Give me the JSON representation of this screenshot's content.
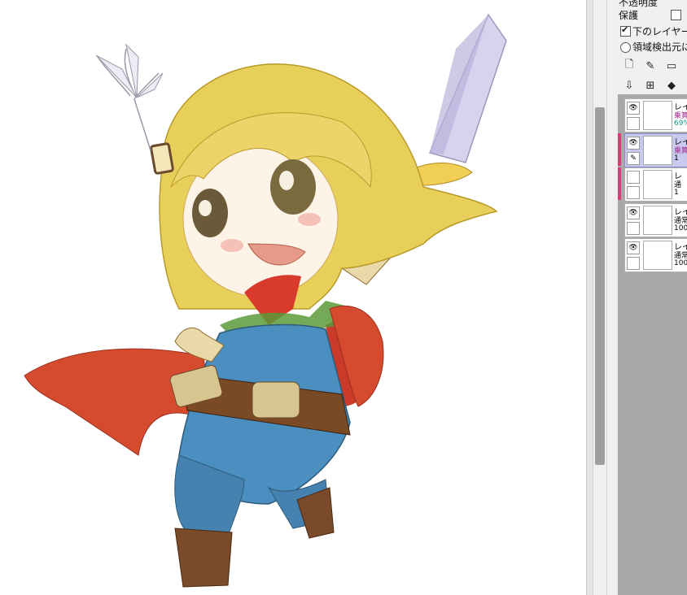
{
  "panel": {
    "top_cut_label": "不透明度",
    "protect_label": "保護",
    "clip_checkbox_label": "下のレイヤーで",
    "clip_checked": true,
    "region_source_label": "領域検出元に",
    "region_checked": false
  },
  "toolbar_row1": [
    {
      "icon": "new-layer-icon"
    },
    {
      "icon": "pen-tool-icon"
    },
    {
      "icon": "layer-folder-icon"
    }
  ],
  "toolbar_row2": [
    {
      "icon": "merge-down-icon"
    },
    {
      "icon": "new-layer-plus-icon"
    },
    {
      "icon": "eraser-icon"
    },
    {
      "icon": "delete-layer-icon"
    }
  ],
  "layers": [
    {
      "name": "レイ",
      "mode": "乗算",
      "opacity": "69%",
      "mode_color": "#a0308a",
      "op_color": "#1a9a8a",
      "visible": true,
      "selected": false,
      "pink": false
    },
    {
      "name": "レイ",
      "mode": "乗算",
      "opacity": "1",
      "mode_color": "#a0308a",
      "op_color": "#111111",
      "visible": true,
      "selected": true,
      "pink": true
    },
    {
      "name": "レ",
      "mode": "通",
      "opacity": "1",
      "mode_color": "#111111",
      "op_color": "#111111",
      "visible": false,
      "selected": false,
      "pink": true
    },
    {
      "name": "レイ",
      "mode": "通常",
      "opacity": "100",
      "mode_color": "#111111",
      "op_color": "#111111",
      "visible": true,
      "selected": false,
      "pink": false
    },
    {
      "name": "レイ",
      "mode": "通常",
      "opacity": "100",
      "mode_color": "#111111",
      "op_color": "#111111",
      "visible": true,
      "selected": false,
      "pink": false
    }
  ],
  "colors": {
    "hair": "#e8cf5a",
    "overalls": "#4a8fbf",
    "cape": "#d64a2e",
    "scarf": "#d83a2c",
    "boots": "#7a4a2a",
    "blade": "#d6d3ee",
    "accent_pink": "#d83c78"
  }
}
